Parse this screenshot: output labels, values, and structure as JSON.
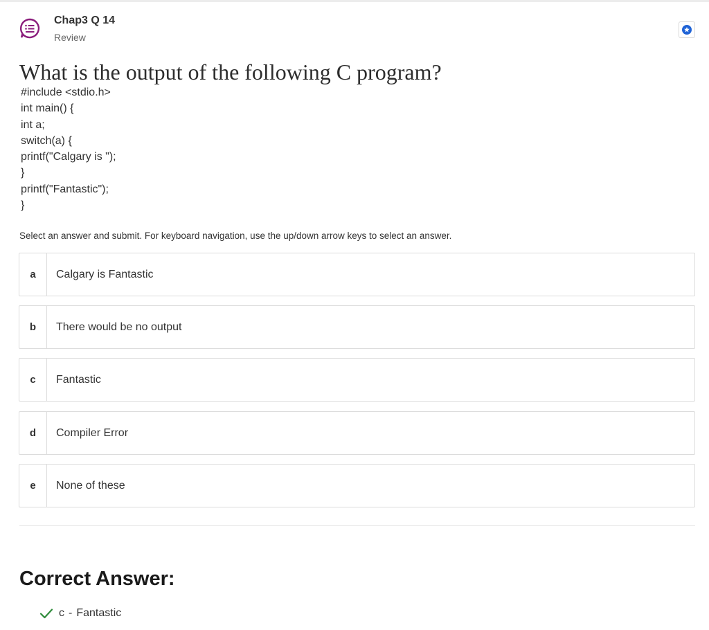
{
  "header": {
    "title": "Chap3 Q 14",
    "subtitle": "Review",
    "accent_color": "#8b1e7d",
    "bookmark_color": "#1f63d6"
  },
  "question": {
    "heading": "What is the output of the following C program?",
    "code_lines": [
      "#include <stdio.h>",
      "int main() {",
      "int a;",
      "switch(a) {",
      "printf(\"Calgary is \");",
      "}",
      "printf(\"Fantastic\");",
      "}"
    ]
  },
  "instructions": "Select an answer and submit. For keyboard navigation, use the up/down arrow keys to select an answer.",
  "options": [
    {
      "letter": "a",
      "text": "Calgary is Fantastic"
    },
    {
      "letter": "b",
      "text": "There would be no output"
    },
    {
      "letter": "c",
      "text": "Fantastic"
    },
    {
      "letter": "d",
      "text": "Compiler Error"
    },
    {
      "letter": "e",
      "text": "None of these"
    }
  ],
  "correct": {
    "heading": "Correct Answer:",
    "letter": "c",
    "separator": "-",
    "text": "Fantastic",
    "check_color": "#2e8b3a"
  }
}
